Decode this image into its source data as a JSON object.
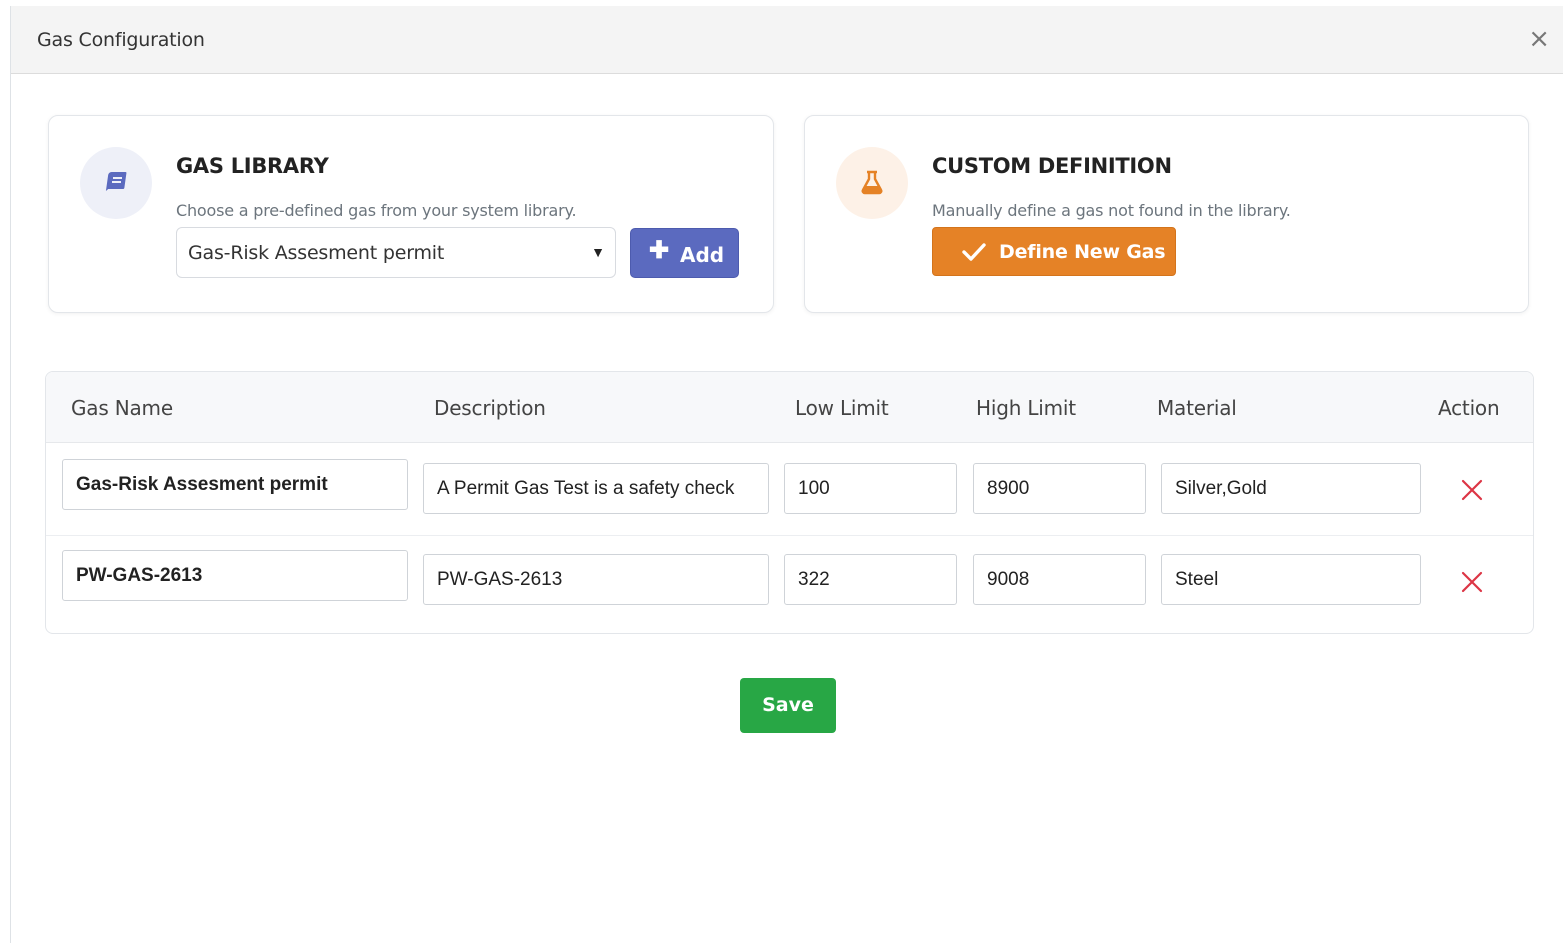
{
  "modal": {
    "title": "Gas Configuration",
    "close_glyph": "×"
  },
  "library_card": {
    "icon": "book-icon",
    "title": "GAS LIBRARY",
    "subtitle": "Choose a pre-defined gas from your system library.",
    "selected_gas": "Gas-Risk Assesment permit",
    "add_label": "Add"
  },
  "custom_card": {
    "icon": "flask-icon",
    "title": "CUSTOM DEFINITION",
    "subtitle": "Manually define a gas not found in the library.",
    "define_label": "Define New Gas"
  },
  "table": {
    "headers": [
      "Gas Name",
      "Description",
      "Low Limit",
      "High Limit",
      "Material",
      "Action"
    ],
    "rows": [
      {
        "gas_name": "Gas-Risk Assesment permit",
        "description": "A Permit Gas Test is a safety check",
        "low_limit": "100",
        "high_limit": "8900",
        "material": "Silver,Gold"
      },
      {
        "gas_name": "PW-GAS-2613",
        "description": "PW-GAS-2613",
        "low_limit": "322",
        "high_limit": "9008",
        "material": "Steel"
      }
    ]
  },
  "save_label": "Save",
  "colors": {
    "add_button": "#5b6abf",
    "define_button": "#e58226",
    "save_button": "#28a745",
    "delete_icon": "#dc3545"
  }
}
